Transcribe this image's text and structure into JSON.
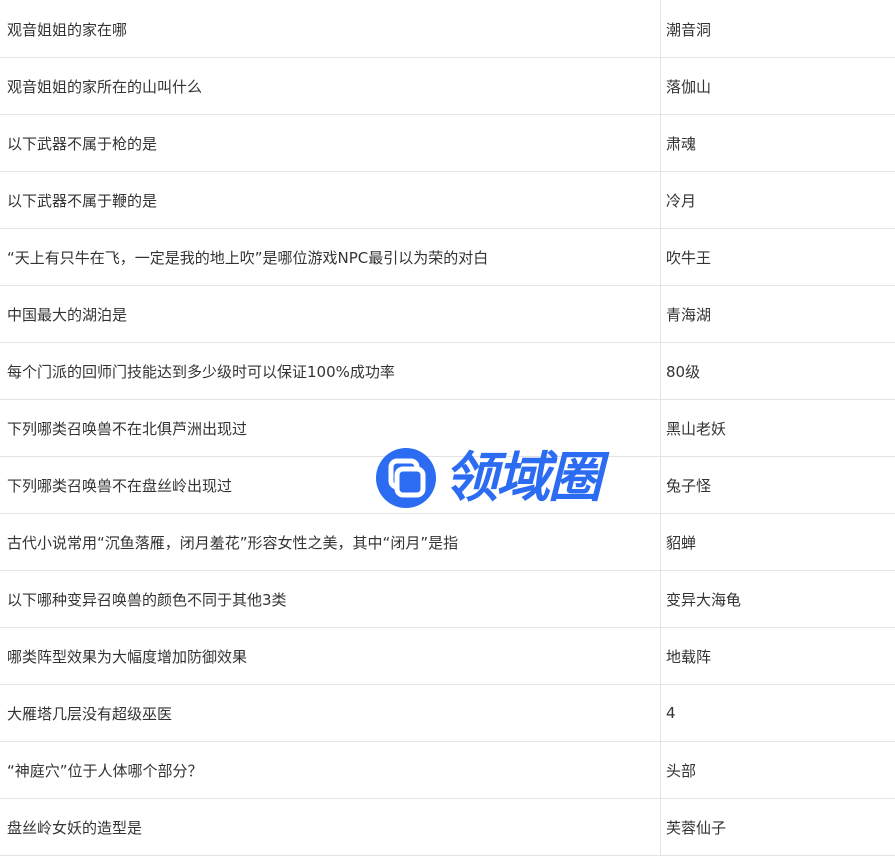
{
  "rows": [
    {
      "question": "观音姐姐的家在哪",
      "answer": "潮音洞"
    },
    {
      "question": "观音姐姐的家所在的山叫什么",
      "answer": "落伽山"
    },
    {
      "question": "以下武器不属于枪的是",
      "answer": "肃魂"
    },
    {
      "question": "以下武器不属于鞭的是",
      "answer": "冷月"
    },
    {
      "question": "“天上有只牛在飞，一定是我的地上吹”是哪位游戏NPC最引以为荣的对白",
      "answer": "吹牛王"
    },
    {
      "question": "中国最大的湖泊是",
      "answer": "青海湖"
    },
    {
      "question": "每个门派的回师门技能达到多少级时可以保证100%成功率",
      "answer": "80级"
    },
    {
      "question": "下列哪类召唤兽不在北俱芦洲出现过",
      "answer": "黑山老妖"
    },
    {
      "question": "下列哪类召唤兽不在盘丝岭出现过",
      "answer": "兔子怪"
    },
    {
      "question": "古代小说常用“沉鱼落雁，闭月羞花”形容女性之美，其中“闭月”是指",
      "answer": "貂蝉"
    },
    {
      "question": "以下哪种变异召唤兽的颜色不同于其他3类",
      "answer": "变异大海龟"
    },
    {
      "question": "哪类阵型效果为大幅度增加防御效果",
      "answer": "地载阵"
    },
    {
      "question": "大雁塔几层没有超级巫医",
      "answer": "4"
    },
    {
      "question": "“神庭穴”位于人体哪个部分？",
      "answer": "头部"
    },
    {
      "question": "盘丝岭女妖的造型是",
      "answer": "芙蓉仙子"
    }
  ],
  "watermark": {
    "text": "领域圈",
    "icon": "app-logo-icon",
    "color": "#2b6cf2"
  }
}
